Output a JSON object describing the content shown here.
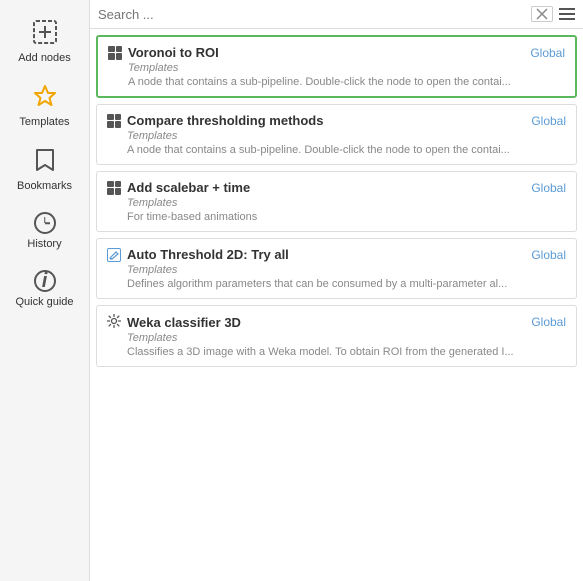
{
  "sidebar": {
    "items": [
      {
        "id": "add-nodes",
        "label": "Add nodes",
        "active": false
      },
      {
        "id": "templates",
        "label": "Templates",
        "active": true
      },
      {
        "id": "bookmarks",
        "label": "Bookmarks",
        "active": false
      },
      {
        "id": "history",
        "label": "History",
        "active": false
      },
      {
        "id": "quick-guide",
        "label": "Quick guide",
        "active": false
      }
    ]
  },
  "search": {
    "placeholder": "Search ..."
  },
  "list": {
    "items": [
      {
        "id": "voronoi",
        "title": "Voronoi to ROI",
        "category": "Templates",
        "description": "A node that contains a sub-pipeline. Double-click the node to open the contai...",
        "badge": "Global",
        "icon": "grid",
        "selected": true
      },
      {
        "id": "compare-threshold",
        "title": "Compare thresholding methods",
        "category": "Templates",
        "description": "A node that contains a sub-pipeline. Double-click the node to open the contai...",
        "badge": "Global",
        "icon": "grid",
        "selected": false
      },
      {
        "id": "add-scalebar",
        "title": "Add scalebar + time",
        "category": "Templates",
        "description": "For time-based animations",
        "badge": "Global",
        "icon": "grid",
        "selected": false
      },
      {
        "id": "auto-threshold",
        "title": "Auto Threshold 2D: Try all",
        "category": "Templates",
        "description": "Defines algorithm parameters that can be consumed by a multi-parameter al...",
        "badge": "Global",
        "icon": "edit",
        "selected": false
      },
      {
        "id": "weka-classifier",
        "title": "Weka classifier 3D",
        "category": "Templates",
        "description": "Classifies a 3D image with a Weka model. To obtain ROI from the generated I...",
        "badge": "Global",
        "icon": "gear",
        "selected": false
      }
    ]
  }
}
